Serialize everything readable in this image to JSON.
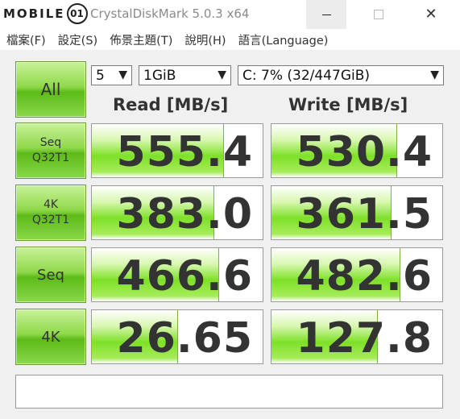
{
  "watermark": {
    "text": "MOBILE",
    "mark": "01"
  },
  "window": {
    "title": "CrystalDiskMark 5.0.3 x64"
  },
  "menu": [
    "檔案(F)",
    "設定(S)",
    "佈景主題(T)",
    "說明(H)",
    "語言(Language)"
  ],
  "controls": {
    "all_label": "All",
    "count": "5",
    "size": "1GiB",
    "drive": "C: 7% (32/447GiB)"
  },
  "headers": {
    "read": "Read [MB/s]",
    "write": "Write [MB/s]"
  },
  "tests": [
    {
      "line1": "Seq",
      "line2": "Q32T1",
      "read": "555.4",
      "write": "530.4",
      "read_fill": 0.77,
      "write_fill": 0.73
    },
    {
      "line1": "4K",
      "line2": "Q32T1",
      "read": "383.0",
      "write": "361.5",
      "read_fill": 0.71,
      "write_fill": 0.7
    },
    {
      "line1": "Seq",
      "line2": "",
      "read": "466.6",
      "write": "482.6",
      "read_fill": 0.74,
      "write_fill": 0.75
    },
    {
      "line1": "4K",
      "line2": "",
      "read": "26.65",
      "write": "127.8",
      "read_fill": 0.5,
      "write_fill": 0.62
    }
  ],
  "status": ""
}
